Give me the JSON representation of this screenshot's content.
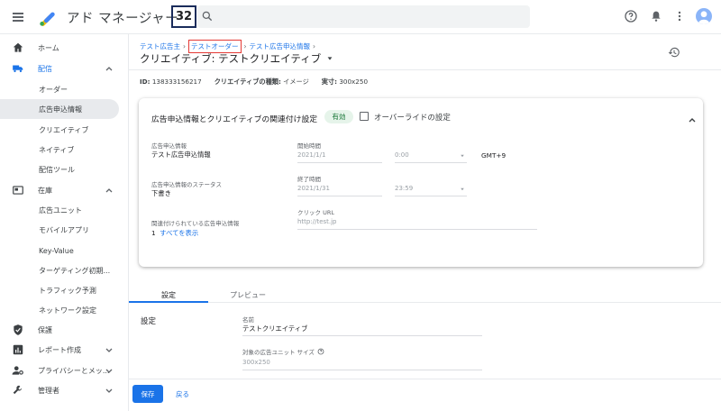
{
  "header": {
    "app_title": "アド マネージャー",
    "network_badge": "32"
  },
  "sidebar": {
    "items": [
      {
        "label": "ホーム"
      },
      {
        "label": "配信"
      },
      {
        "label": "オーダー"
      },
      {
        "label": "広告申込情報"
      },
      {
        "label": "クリエイティブ"
      },
      {
        "label": "ネイティブ"
      },
      {
        "label": "配信ツール"
      },
      {
        "label": "在庫"
      },
      {
        "label": "広告ユニット"
      },
      {
        "label": "モバイルアプリ"
      },
      {
        "label": "Key-Value"
      },
      {
        "label": "ターゲティング初期..."
      },
      {
        "label": "トラフィック予測"
      },
      {
        "label": "ネットワーク設定"
      },
      {
        "label": "保護"
      },
      {
        "label": "レポート作成"
      },
      {
        "label": "プライバシーとメッ..."
      },
      {
        "label": "管理者"
      }
    ]
  },
  "breadcrumb": {
    "items": [
      "テスト広告主",
      "テストオーダー",
      "テスト広告申込情報"
    ],
    "separator": "›"
  },
  "page": {
    "title": "クリエイティブ: テストクリエイティブ",
    "meta": {
      "id_label": "ID:",
      "id_value": "138333156217",
      "type_label": "クリエイティブの種類:",
      "type_value": "イメージ",
      "size_label": "実寸:",
      "size_value": "300x250"
    }
  },
  "card": {
    "title": "広告申込情報とクリエイティブの関連付け設定",
    "status_badge": "有効",
    "override_label": "オーバーライドの設定",
    "lineitem_label": "広告申込情報",
    "lineitem_value": "テスト広告申込情報",
    "status_label": "広告申込情報のステータス",
    "status_value": "下書き",
    "related_label": "関連付けられている広告申込情報",
    "related_count": "1",
    "related_link": "すべてを表示",
    "start_label": "開始時間",
    "start_date": "2021/1/1",
    "start_time": "0:00",
    "timezone": "GMT+9",
    "end_label": "終了時間",
    "end_date": "2021/1/31",
    "end_time": "23:59",
    "click_url_label": "クリック URL",
    "click_url_placeholder": "http://test.jp"
  },
  "tabs": [
    {
      "label": "設定"
    },
    {
      "label": "プレビュー"
    }
  ],
  "settings": {
    "section_title": "設定",
    "name_label": "名前",
    "name_value": "テストクリエイティブ",
    "size_label": "対象の広告ユニット サイズ",
    "size_placeholder": "300x250"
  },
  "footer": {
    "save_label": "保存",
    "back_label": "戻る"
  },
  "colors": {
    "accent": "#1a73e8",
    "highlight_border": "#e53935",
    "badge_bg": "#e6f4ea",
    "badge_text": "#137333"
  }
}
